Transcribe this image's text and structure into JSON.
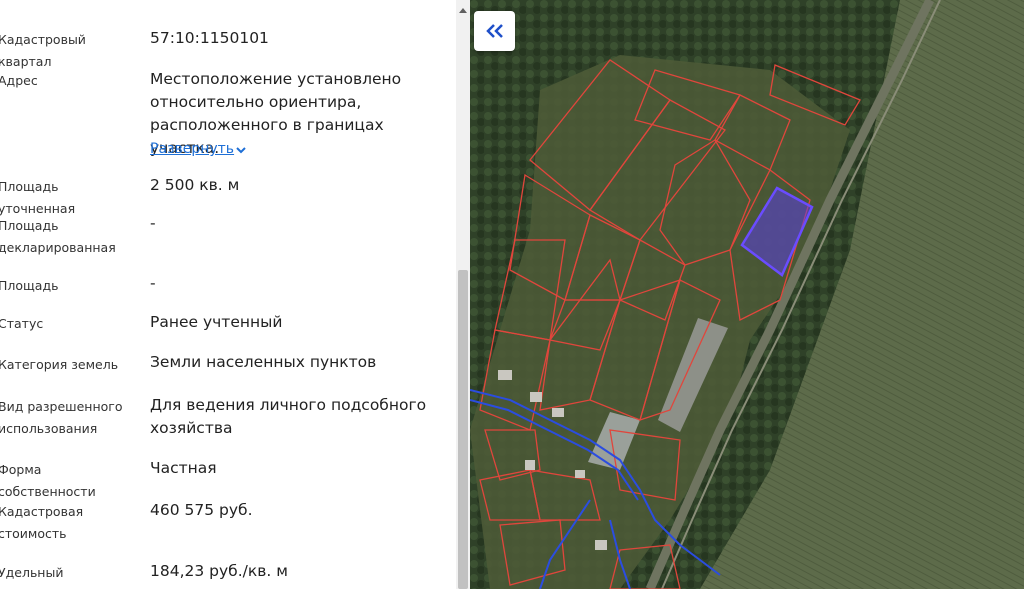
{
  "panel": {
    "rows": [
      {
        "label": "Кадастровый квартал",
        "value": "57:10:1150101"
      },
      {
        "label": "Адрес",
        "value_lines": [
          "Местоположение установлено",
          "относительно ориентира,",
          "расположенного в границах участка."
        ],
        "expand_label": "Развернуть"
      },
      {
        "label": "Площадь уточненная",
        "value": "2 500 кв. м"
      },
      {
        "label_lines": [
          "Площадь",
          "декларированная"
        ],
        "value": "-"
      },
      {
        "label": "Площадь",
        "value": "-"
      },
      {
        "label": "Статус",
        "value": "Ранее учтенный"
      },
      {
        "label": "Категория земель",
        "value": "Земли населенных пунктов"
      },
      {
        "label_lines": [
          "Вид разрешенного",
          "использования"
        ],
        "value_lines": [
          "Для ведения личного подсобного",
          "хозяйства"
        ]
      },
      {
        "label": "Форма собственности",
        "value": "Частная"
      },
      {
        "label_lines": [
          "Кадастровая",
          "стоимость"
        ],
        "value": "460 575 руб."
      },
      {
        "label": "Удельный показатель",
        "value": "184,23 руб./кв. м"
      }
    ]
  },
  "map": {
    "parcel_color": "#e0463c",
    "selected_parcel_color": "#5b3cf0",
    "road_color": "#2b4de0"
  },
  "icons": {
    "collapse": "double-chevron-left-icon",
    "expand": "chevron-down-icon",
    "scroll_up": "triangle-up-icon"
  }
}
